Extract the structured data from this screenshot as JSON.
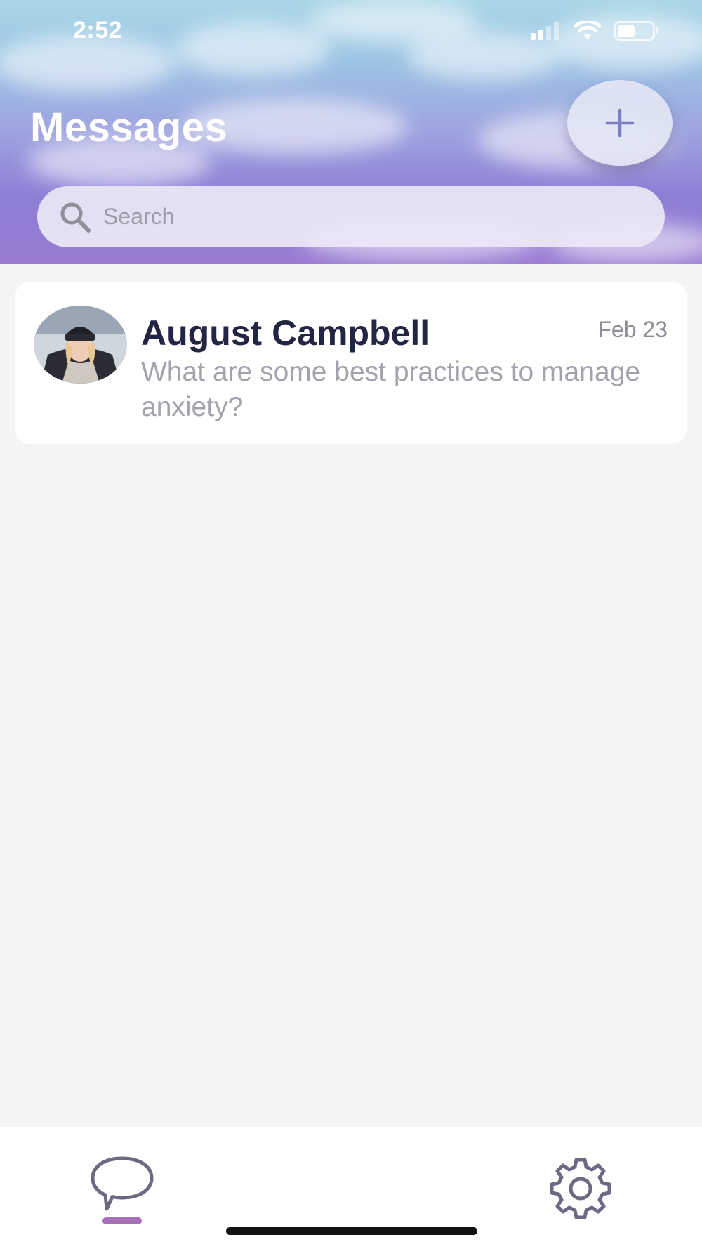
{
  "status_bar": {
    "time": "2:52",
    "icons": [
      "cellular-signal-icon",
      "wifi-icon",
      "battery-icon"
    ]
  },
  "header": {
    "title": "Messages",
    "add_button_icon": "plus-icon"
  },
  "search": {
    "placeholder": "Search",
    "value": ""
  },
  "conversations": [
    {
      "name": "August Campbell",
      "date": "Feb 23",
      "preview": "What are some best practices to manage anxiety?"
    }
  ],
  "tab_bar": {
    "items": [
      {
        "icon": "chat-bubble-icon",
        "active": true
      },
      {
        "icon": "gear-icon",
        "active": false
      }
    ]
  },
  "colors": {
    "accent": "#7b7fc8",
    "title_text": "#222543",
    "tab_indicator": "#a770b8",
    "icon_gray": "#6b6a82"
  }
}
